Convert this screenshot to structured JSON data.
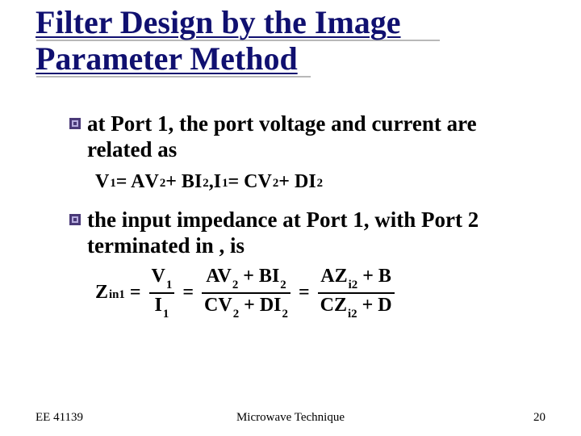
{
  "title": "Filter Design by the Image Parameter Method",
  "bullets": [
    {
      "text": "at Port 1, the port voltage and current are related as",
      "equation": {
        "type": "inline",
        "parts": {
          "v1": "V",
          "v1s": "1",
          "eq1": " = A",
          "av": "V",
          "avs": "2",
          "pb": " + B",
          "bi": "I",
          "bis": "2",
          "comma": ", ",
          "i1": "I",
          "i1s": "1",
          "eq2": " = C",
          "cv": "V",
          "cvs": "2",
          "pd": " + D",
          "di": "I",
          "dis": "2"
        }
      }
    },
    {
      "text": "the input impedance at Port 1, with Port 2 terminated in  , is",
      "equation": {
        "type": "frac",
        "lhs": {
          "z": "Z",
          "zs": "in1",
          "eq": " = "
        },
        "frac1": {
          "numA": "V",
          "numAs": "1",
          "denA": "I",
          "denAs": "1"
        },
        "mid1": " = ",
        "frac2": {
          "numL": "A",
          "numV": "V",
          "numVs": "2",
          "numP": " + B",
          "numI": "I",
          "numIs": "2",
          "denL": "C",
          "denV": "V",
          "denVs": "2",
          "denP": " + D",
          "denI": "I",
          "denIs": "2"
        },
        "mid2": " = ",
        "frac3": {
          "numL": "A",
          "numZ": "Z",
          "numZs": "i2",
          "numP": " + B",
          "denL": "C",
          "denZ": "Z",
          "denZs": "i2",
          "denP": " + D"
        }
      }
    }
  ],
  "footer": {
    "left": "EE 41139",
    "center": "Microwave Technique",
    "right": "20"
  }
}
